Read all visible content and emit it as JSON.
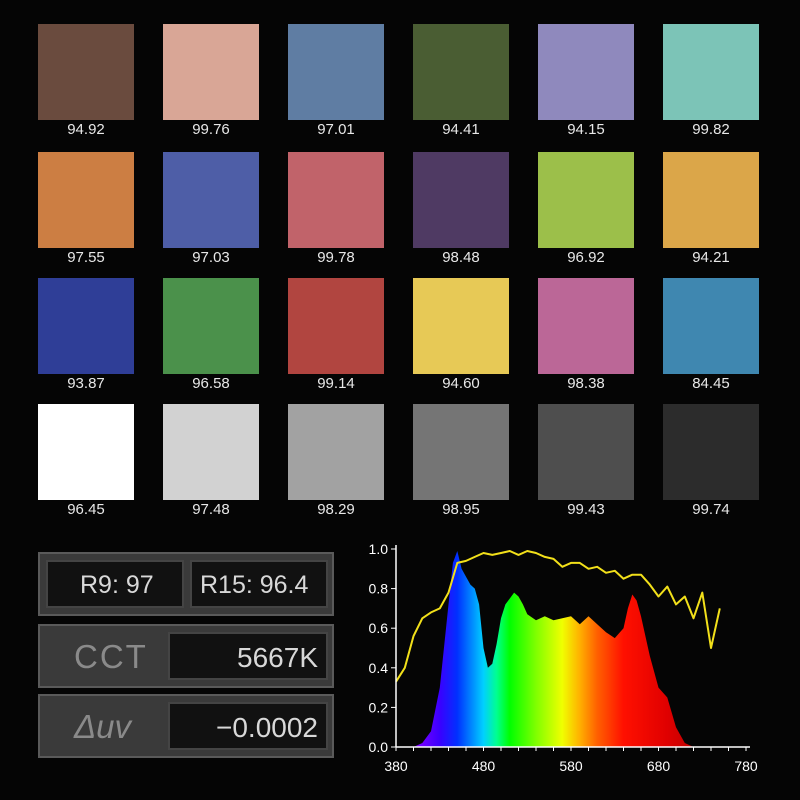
{
  "swatches": [
    {
      "color": "#6a4b3e",
      "value": "94.92"
    },
    {
      "color": "#d9a696",
      "value": "99.76"
    },
    {
      "color": "#5f7da3",
      "value": "97.01"
    },
    {
      "color": "#4a5d33",
      "value": "94.41"
    },
    {
      "color": "#8f89bd",
      "value": "94.15"
    },
    {
      "color": "#7cc4b7",
      "value": "99.82"
    },
    {
      "color": "#cc7e43",
      "value": "97.55"
    },
    {
      "color": "#4e5ea7",
      "value": "97.03"
    },
    {
      "color": "#c1636a",
      "value": "99.78"
    },
    {
      "color": "#4f3a63",
      "value": "98.48"
    },
    {
      "color": "#9cbf4a",
      "value": "96.92"
    },
    {
      "color": "#dba649",
      "value": "94.21"
    },
    {
      "color": "#2f3e97",
      "value": "93.87"
    },
    {
      "color": "#4b914b",
      "value": "96.58"
    },
    {
      "color": "#b14540",
      "value": "99.14"
    },
    {
      "color": "#e7c956",
      "value": "94.60"
    },
    {
      "color": "#bb6797",
      "value": "98.38"
    },
    {
      "color": "#3f87b0",
      "value": "84.45"
    },
    {
      "color": "#ffffff",
      "value": "96.45"
    },
    {
      "color": "#d2d2d2",
      "value": "97.48"
    },
    {
      "color": "#a2a2a2",
      "value": "98.29"
    },
    {
      "color": "#757575",
      "value": "98.95"
    },
    {
      "color": "#4e4e4e",
      "value": "99.43"
    },
    {
      "color": "#2c2c2c",
      "value": "99.74"
    }
  ],
  "metrics": {
    "r9": "R9: 97",
    "r15": "R15: 96.4",
    "cct_label": "CCT",
    "cct_value": "5667K",
    "duv_label": "Δuv",
    "duv_value": "−0.0002"
  },
  "chart_data": {
    "type": "area",
    "xlim": [
      380,
      780
    ],
    "ylim": [
      0,
      1.0
    ],
    "x_ticks": [
      380,
      480,
      580,
      680,
      780
    ],
    "x_tick_labels": [
      "380",
      "480",
      "580",
      "680",
      "780"
    ],
    "y_ticks": [
      0.0,
      0.2,
      0.4,
      0.6,
      0.8,
      1.0
    ],
    "y_tick_labels": [
      "0.0",
      "0.2",
      "0.4",
      "0.6",
      "0.8",
      "1.0"
    ],
    "series": [
      {
        "kind": "spectrum",
        "x": [
          380,
          400,
          410,
          420,
          430,
          440,
          445,
          450,
          455,
          460,
          465,
          470,
          475,
          480,
          485,
          490,
          495,
          500,
          505,
          510,
          515,
          520,
          525,
          530,
          540,
          550,
          560,
          570,
          580,
          590,
          600,
          610,
          620,
          630,
          640,
          645,
          650,
          655,
          660,
          670,
          680,
          690,
          700,
          710,
          720
        ],
        "y": [
          0,
          0,
          0.02,
          0.08,
          0.3,
          0.72,
          0.93,
          0.99,
          0.9,
          0.86,
          0.82,
          0.8,
          0.72,
          0.5,
          0.4,
          0.42,
          0.52,
          0.65,
          0.72,
          0.75,
          0.78,
          0.76,
          0.72,
          0.67,
          0.64,
          0.66,
          0.64,
          0.65,
          0.66,
          0.62,
          0.66,
          0.62,
          0.58,
          0.55,
          0.6,
          0.7,
          0.77,
          0.74,
          0.66,
          0.46,
          0.3,
          0.25,
          0.1,
          0.02,
          0
        ]
      },
      {
        "kind": "ratio-line",
        "color": "#f2e01a",
        "x": [
          380,
          390,
          400,
          410,
          420,
          430,
          440,
          450,
          460,
          470,
          480,
          490,
          500,
          510,
          520,
          530,
          540,
          550,
          560,
          570,
          580,
          590,
          600,
          610,
          620,
          630,
          640,
          650,
          660,
          670,
          680,
          690,
          700,
          710,
          720,
          730,
          740,
          750
        ],
        "y": [
          0.33,
          0.4,
          0.56,
          0.65,
          0.68,
          0.7,
          0.78,
          0.93,
          0.94,
          0.96,
          0.98,
          0.97,
          0.98,
          0.99,
          0.97,
          0.99,
          0.98,
          0.96,
          0.95,
          0.91,
          0.93,
          0.93,
          0.9,
          0.91,
          0.88,
          0.89,
          0.85,
          0.87,
          0.87,
          0.82,
          0.76,
          0.81,
          0.72,
          0.76,
          0.65,
          0.78,
          0.5,
          0.7
        ]
      }
    ]
  }
}
